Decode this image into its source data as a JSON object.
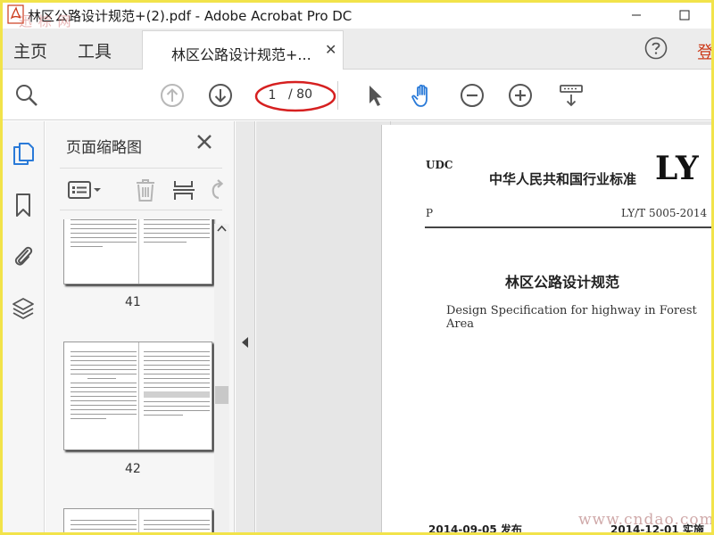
{
  "window": {
    "title": "林区公路设计规范+(2).pdf - Adobe Acrobat Pro DC",
    "watermark": "迅 棕 网"
  },
  "nav": {
    "home": "主页",
    "tools": "工具",
    "doc_tab": "林区公路设计规范+...",
    "doc_tab_close": "✕",
    "right_clip": "登"
  },
  "toolbar": {
    "page_current": "1",
    "page_total": "/ 80",
    "icons": [
      "zoom-search-icon",
      "page-up-icon",
      "page-down-icon",
      "select-arrow-icon",
      "hand-icon",
      "zoom-out-icon",
      "zoom-in-icon",
      "marquee-zoom-icon"
    ]
  },
  "sidebar": {
    "panel_title": "页面缩略图",
    "thumbnails": [
      {
        "label": "41"
      },
      {
        "label": "42"
      },
      {
        "label": ""
      }
    ]
  },
  "document": {
    "udc": "UDC",
    "standard_cn": "中华人民共和国行业标准",
    "ly": "LY",
    "class_p": "P",
    "code": "LY/T 5005-2014",
    "title_cn": "林区公路设计规范",
    "title_en": "Design Specification for highway in Forest Area",
    "publish": "2014-09-05  发布",
    "implement": "2014-12-01  实施",
    "watermark": "www.cndao.com"
  },
  "colors": {
    "accent_blue": "#2a7ad8",
    "annotation_red": "#d62020",
    "frame_yellow": "#f2e34a",
    "acrobat_red": "#cc3b1b"
  }
}
